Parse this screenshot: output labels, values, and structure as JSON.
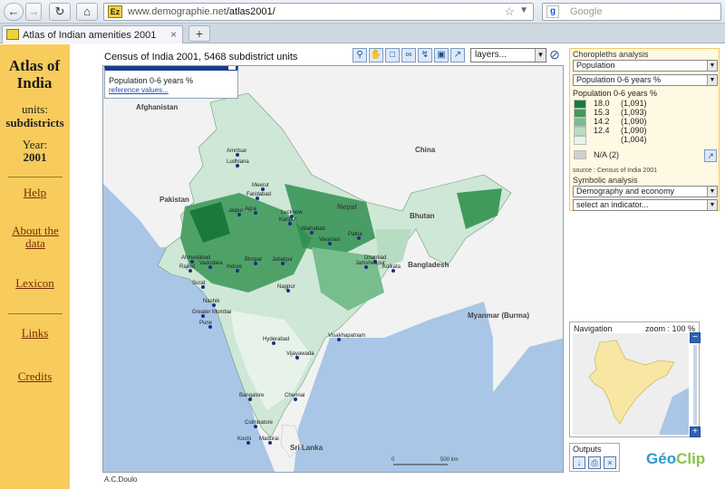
{
  "browser": {
    "url_host": "www.demographie.net",
    "url_path": "/atlas2001/",
    "search_placeholder": "Google",
    "tab_title": "Atlas of Indian amenities 2001",
    "new_tab": "+",
    "favicon_text": "Ez"
  },
  "sidebar": {
    "title": "Atlas of India",
    "units_label": "units:",
    "units_value": "subdistricts",
    "year_label": "Year:",
    "year_value": "2001",
    "links": [
      "Help",
      "About the data",
      "Lexicon",
      "Links",
      "Credits"
    ]
  },
  "map": {
    "title": "Census of India 2001, 5468 subdistrict units",
    "layers_select": "layers...",
    "popup_title": "Population 0-6 years %",
    "popup_link": "reference values...",
    "author": "A.C.Doulo",
    "scale_start": "0",
    "scale_end": "500 km",
    "countries": [
      "Afghanistan",
      "Pakistan",
      "China",
      "Nepal",
      "Bhutan",
      "Bangladesh",
      "Myanmar (Burma)",
      "Sri Lanka"
    ],
    "cities": [
      "Amritsar",
      "Ludhiana",
      "Meerut",
      "Faridabad",
      "Jaipur",
      "Agra",
      "Lucknow",
      "Kanpur",
      "Allahabad",
      "Varanasi",
      "Patna",
      "Dhanbad",
      "Jamshedpur",
      "Kolkata",
      "Ahmedabad",
      "Rajkot",
      "Vadodara",
      "Indore",
      "Bhopal",
      "Jabalpur",
      "Surat",
      "Nashik",
      "Greater Mumbai",
      "Pune",
      "Nagpur",
      "Hyderabad",
      "Vijayawada",
      "Visakhapatnam",
      "Bangalore",
      "Chennai",
      "Coimbatore",
      "Kochi",
      "Madurai"
    ]
  },
  "panel": {
    "section_title": "Choropleths analysis",
    "theme_select": "Population",
    "indicator_select": "Population 0-6 years %",
    "legend_title": "Population 0-6 years %",
    "legend": [
      {
        "value": "18.0",
        "count": "(1,091)",
        "color": "#1a7a3e"
      },
      {
        "value": "15.3",
        "count": "(1,093)",
        "color": "#3f9a5c"
      },
      {
        "value": "14.2",
        "count": "(1,090)",
        "color": "#78bd8e"
      },
      {
        "value": "12.4",
        "count": "(1,090)",
        "color": "#b7dcc2"
      },
      {
        "value": "",
        "count": "(1,004)",
        "color": "#e6f2ea"
      }
    ],
    "na_label": "N/A (2)",
    "na_color": "#d0d0d0",
    "source": "source : Census of India 2001",
    "symbolic_title": "Symbolic analysis",
    "symbolic_select": "Demography and economy",
    "symbolic_indicator": "select an indicator..."
  },
  "navigation": {
    "title": "Navigation",
    "zoom": "zoom : 100 %",
    "zoom_in": "+",
    "zoom_out": "−"
  },
  "outputs": {
    "title": "Outputs",
    "brand_a": "G",
    "brand_b": "éo",
    "brand_c": "Clip"
  },
  "colors": {
    "sidebar": "#f7cc5c",
    "map_green": "#2f8f50",
    "sea": "#a9c6e6",
    "land": "#f3f3f3"
  }
}
